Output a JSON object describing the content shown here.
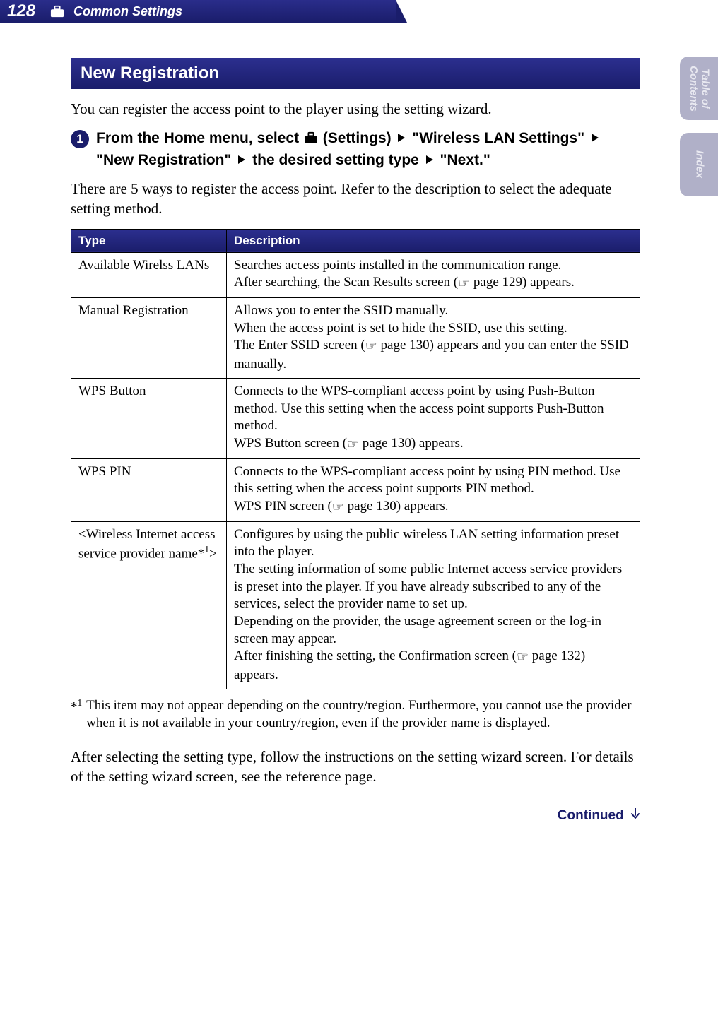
{
  "header": {
    "page_number": "128",
    "section_title": "Common Settings",
    "section_icon": "settings-icon"
  },
  "side_tabs": {
    "toc": "Table of\nContents",
    "index": "Index"
  },
  "heading": "New Registration",
  "intro_text": "You can register the access point to the player using the setting wizard.",
  "step": {
    "number": "1",
    "parts": {
      "a": "From the Home menu, select ",
      "b": " (Settings) ",
      "c": " \"Wireless LAN Settings\" ",
      "d": " \"New Registration\" ",
      "e": " the desired setting type ",
      "f": " \"Next.\""
    }
  },
  "after_step_text": "There are 5 ways to register the access point. Refer to the description to select the adequate setting method.",
  "table": {
    "headers": {
      "type": "Type",
      "description": "Description"
    },
    "rows": [
      {
        "type": "Available Wirelss LANs",
        "desc_lines": [
          "Searches access points installed in the communication range.",
          "After searching, the Scan Results screen ( page 129) appears."
        ],
        "pages": [
          "129"
        ]
      },
      {
        "type": "Manual Registration",
        "desc_lines": [
          "Allows you to enter the SSID manually.",
          "When the access point is set to hide the SSID, use this setting.",
          "The Enter SSID screen ( page 130) appears and you can enter the SSID manually."
        ],
        "pages": [
          "130"
        ]
      },
      {
        "type": "WPS Button",
        "desc_lines": [
          "Connects to the WPS-compliant access point by using Push-Button method. Use this setting when the access point supports Push-Button method.",
          "WPS Button screen ( page 130) appears."
        ],
        "pages": [
          "130"
        ]
      },
      {
        "type": "WPS PIN",
        "desc_lines": [
          "Connects to the WPS-compliant access point by using PIN method. Use this setting when the access point supports PIN method.",
          "WPS PIN screen ( page 130) appears."
        ],
        "pages": [
          "130"
        ]
      },
      {
        "type": "<Wireless Internet access service provider name*¹>",
        "desc_lines": [
          "Configures by using the public wireless LAN setting information preset into the player.",
          "The setting information of some public Internet access service providers is preset into the player. If you have already subscribed to any of the services, select the provider name to set up.",
          "Depending on the provider, the usage agreement screen or the log-in screen may appear.",
          "After finishing the setting, the Confirmation screen ( page 132) appears."
        ],
        "pages": [
          "132"
        ]
      }
    ]
  },
  "footnote": {
    "marker": "*¹",
    "text": "This item may not appear depending on the country/region. Furthermore, you cannot use the provider when it is not available in your country/region, even if the provider name is displayed."
  },
  "closing_text": "After selecting the setting type, follow the instructions on the setting wizard screen. For details of the setting wizard screen, see the reference page.",
  "continued": "Continued"
}
